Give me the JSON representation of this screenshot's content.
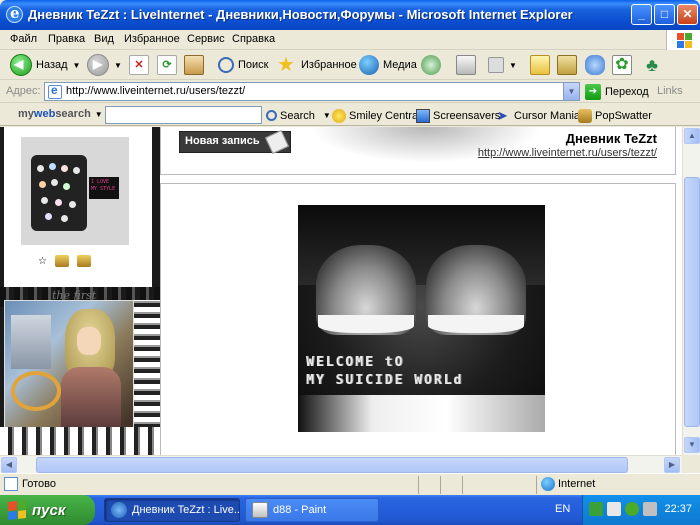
{
  "window": {
    "title": "Дневник TeZzt : LiveInternet - Дневники,Новости,Форумы - Microsoft Internet Explorer",
    "controls": {
      "minimize": "_",
      "maximize": "□",
      "close": "✕"
    }
  },
  "menu": [
    "Файл",
    "Правка",
    "Вид",
    "Избранное",
    "Сервис",
    "Справка"
  ],
  "toolbar": {
    "back": "Назад",
    "search": "Поиск",
    "favorites": "Избранное",
    "media": "Медиа"
  },
  "address": {
    "label": "Адрес:",
    "url": "http://www.liveinternet.ru/users/tezzt/",
    "go": "Переход",
    "links": "Links"
  },
  "searchbar": {
    "logo_my": "my",
    "logo_web": "web",
    "logo_search": "search",
    "input_value": "",
    "search_label": "Search",
    "smiley": "Smiley Central",
    "screensavers": "Screensavers",
    "cursor": "Cursor Mania",
    "popswatter": "PopSwatter"
  },
  "page": {
    "new_post": "Новая запись",
    "diary_title": "Дневник TeZzt",
    "diary_url": "http://www.liveinternet.ru/users/tezzt/",
    "avatar_tag": "I LOVE MY STYLE",
    "grunge_text": "the first",
    "post_caption_1": "WELCOME tO",
    "post_caption_2": "MY SUICIDE WORLd"
  },
  "status": {
    "text": "Готово",
    "zone": "Internet"
  },
  "taskbar": {
    "start": "пуск",
    "tasks": [
      "Дневник TeZzt : Live...",
      "d88 - Paint"
    ],
    "lang": "EN",
    "clock": "22:37"
  },
  "colors": {
    "titlebar": "#0a5fe8",
    "taskbar": "#245edb",
    "start": "#3ca03c"
  }
}
